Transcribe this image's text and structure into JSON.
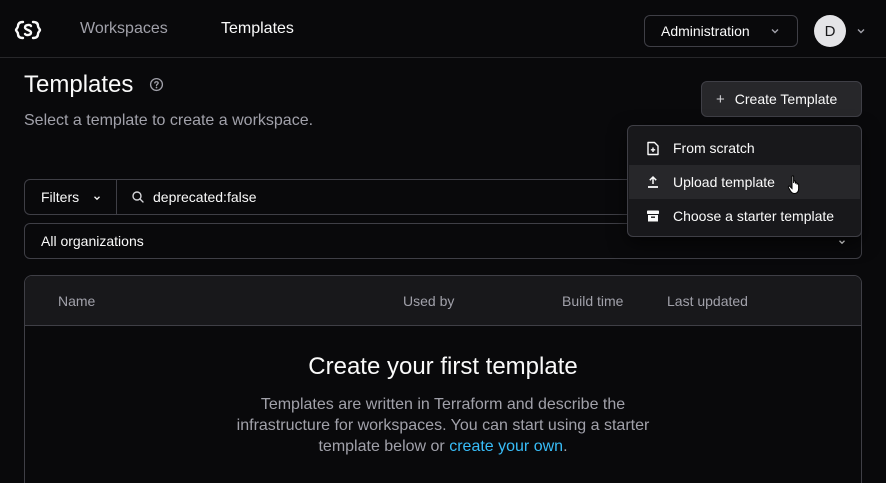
{
  "navbar": {
    "logo_icon": "coder-logo-icon",
    "links": [
      {
        "label": "Workspaces",
        "active": false
      },
      {
        "label": "Templates",
        "active": true
      }
    ],
    "admin_label": "Administration",
    "avatar_initial": "D"
  },
  "header": {
    "title": "Templates",
    "subtitle": "Select a template to create a workspace.",
    "create_label": "Create Template"
  },
  "filters": {
    "button_label": "Filters",
    "search_value": "deprecated:false",
    "org_label": "All organizations"
  },
  "table": {
    "columns": [
      "Name",
      "Used by",
      "Build time",
      "Last updated"
    ],
    "empty_title": "Create your first template",
    "empty_desc_text": "Templates are written in Terraform and describe the infrastructure for workspaces. You can start using a starter template below or",
    "empty_desc_link": "create your own",
    "empty_desc_end": "."
  },
  "menu": {
    "items": [
      {
        "label": "From scratch",
        "icon": "file-plus-icon"
      },
      {
        "label": "Upload template",
        "icon": "upload-icon"
      },
      {
        "label": "Choose a starter template",
        "icon": "archive-icon"
      }
    ],
    "hovered_index": 1
  },
  "colors": {
    "background": "#09090b",
    "surface": "#18181b",
    "border": "#3f3f46",
    "link": "#38bdf8"
  }
}
